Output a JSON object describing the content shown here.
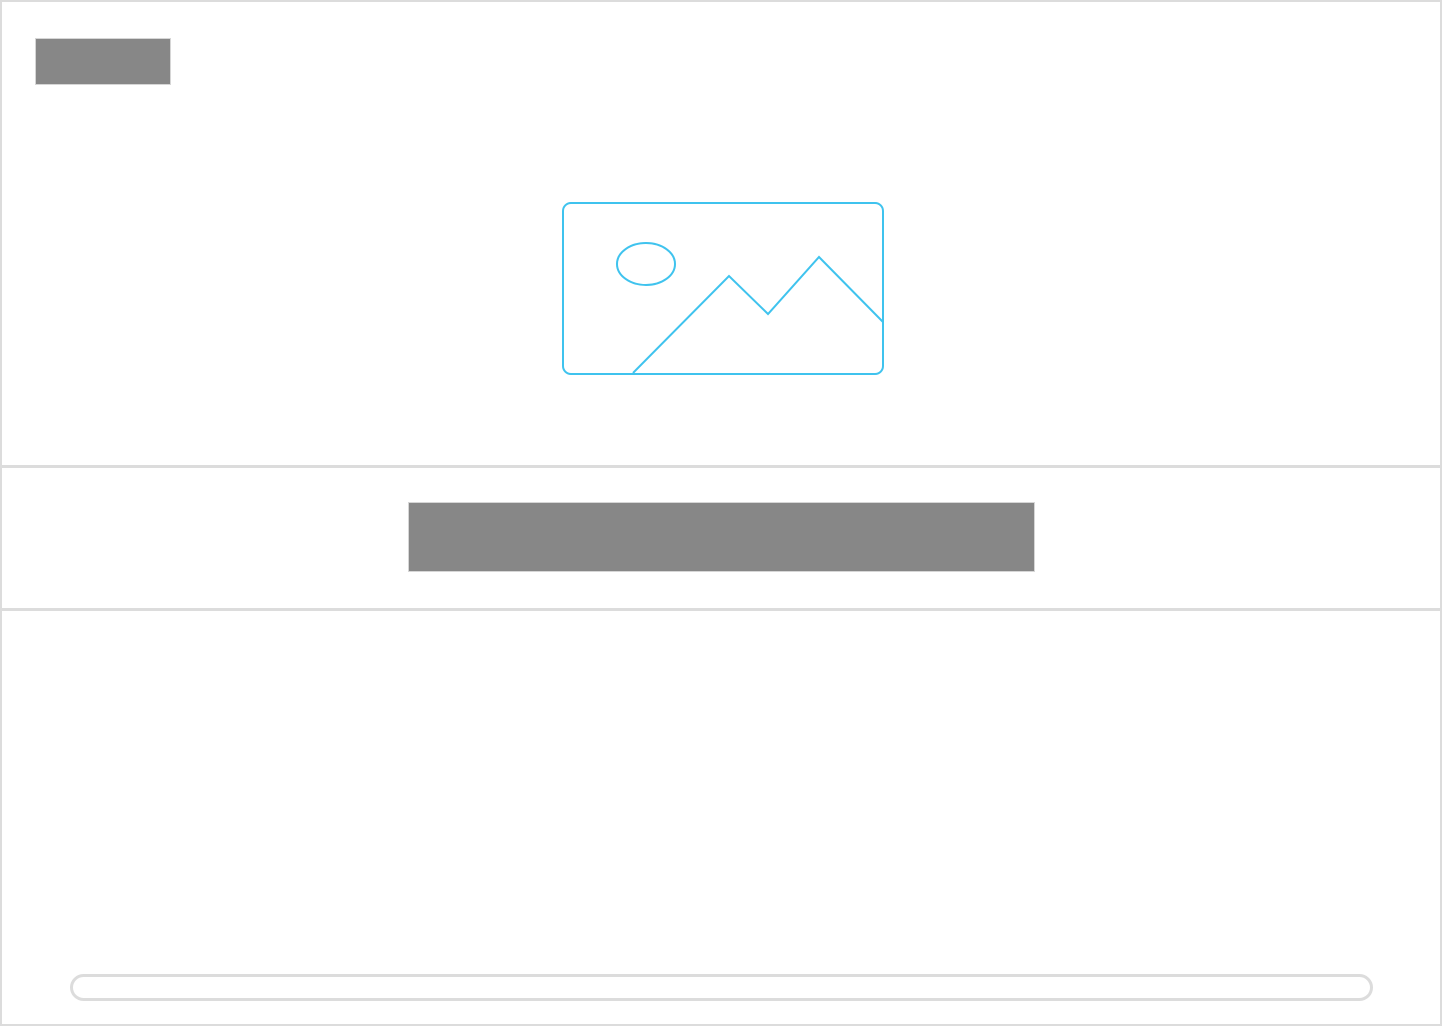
{
  "colors": {
    "frame_border": "#dcdcdc",
    "placeholder_fill": "#878787",
    "image_stroke": "#3fc3ee",
    "background": "#ffffff"
  },
  "icons": {
    "hero": "image-placeholder-icon"
  }
}
